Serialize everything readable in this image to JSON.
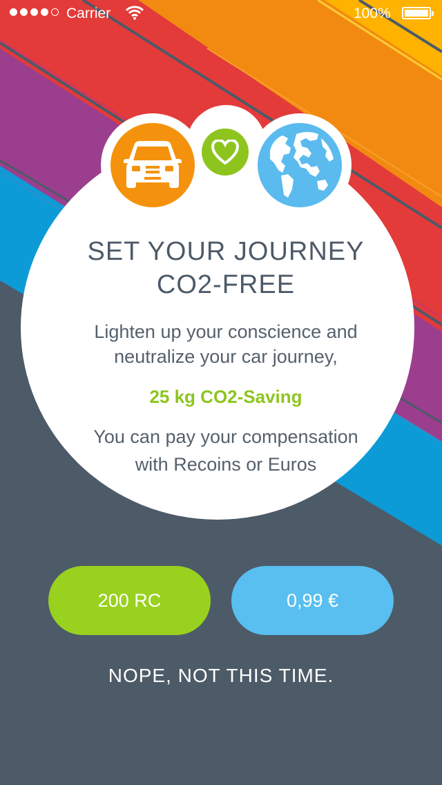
{
  "status_bar": {
    "carrier": "Carrier",
    "battery": "100%",
    "signal_filled": 4,
    "signal_total": 5
  },
  "colors": {
    "background": "#4d5a68",
    "green": "#99d11f",
    "blue": "#58bff0",
    "orange": "#f5920d",
    "red": "#e33a3a",
    "purple": "#9b3e8e",
    "yellow": "#ffb300"
  },
  "card": {
    "icons": [
      "car-icon",
      "heart-icon",
      "globe-icon"
    ],
    "title_line1": "SET YOUR JOURNEY",
    "title_line2": "CO2-FREE",
    "desc_line1": "Lighten up your conscience and",
    "desc_line2": "neutralize your car journey,",
    "saving": "25 kg CO2-Saving",
    "pay_line1": "You can pay your compensation",
    "pay_line2": "with Recoins or Euros"
  },
  "buttons": {
    "recoins": "200 RC",
    "euros": "0,99 €"
  },
  "decline": "NOPE, NOT THIS TIME."
}
